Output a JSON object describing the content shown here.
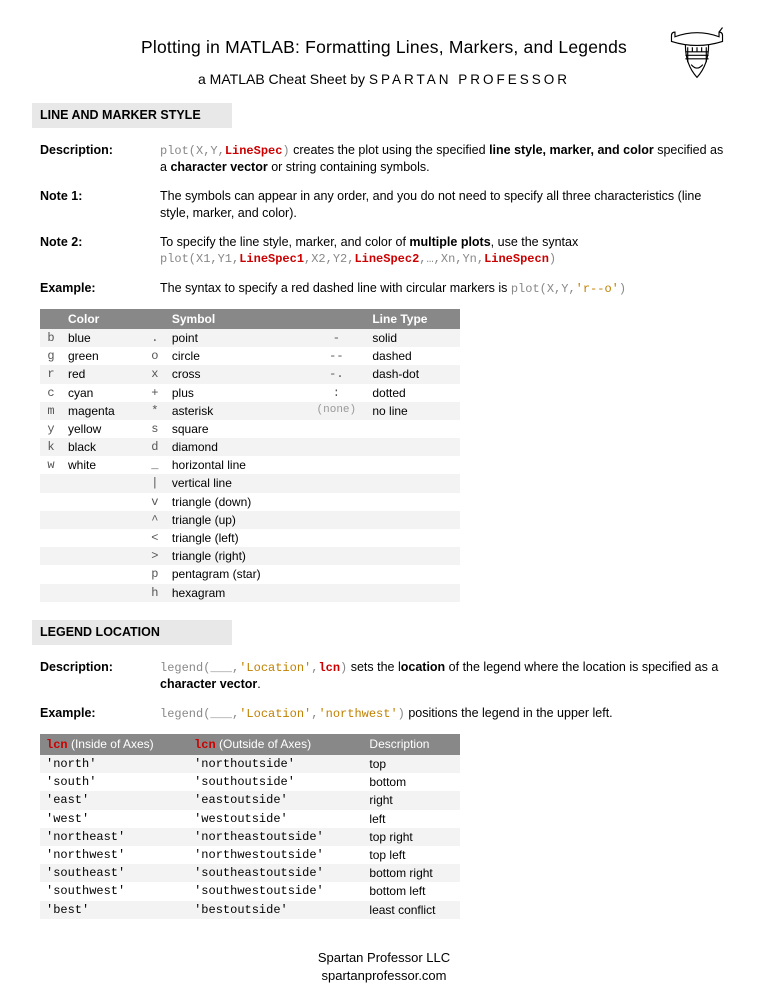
{
  "title": "Plotting in MATLAB: Formatting Lines, Markers, and Legends",
  "subtitle_prefix": "a MATLAB Cheat Sheet by ",
  "brand": "SPARTAN PROFESSOR",
  "section1": {
    "heading": "LINE AND MARKER STYLE",
    "desc_label": "Description:",
    "desc_code_pre": "plot(X,Y,",
    "desc_code_ls": "LineSpec",
    "desc_code_post": ")",
    "desc_text_a": " creates the plot using the specified ",
    "desc_text_b": "line style, marker, and color",
    "desc_text_c": " specified as a ",
    "desc_text_d": "character vector",
    "desc_text_e": " or string containing symbols.",
    "note1_label": "Note 1:",
    "note1_text": "The symbols can appear in any order, and you do not need to specify all three characteristics (line style, marker, and color).",
    "note2_label": "Note 2:",
    "note2_text_a": "To specify the line style, marker, and color of ",
    "note2_text_b": "multiple plots",
    "note2_text_c": ", use the syntax",
    "note2_code_pre": "plot(X1,Y1,",
    "note2_code_ls1": "LineSpec1",
    "note2_code_m1": ",X2,Y2,",
    "note2_code_ls2": "LineSpec2",
    "note2_code_m2": ",…,Xn,Yn,",
    "note2_code_ls3": "LineSpecn",
    "note2_code_post": ")",
    "ex_label": "Example:",
    "ex_text": "The syntax to specify a red dashed line with circular markers is ",
    "ex_code": "plot(X,Y,",
    "ex_code_str": "'r--o'",
    "ex_code_end": ")",
    "table": {
      "headers": {
        "color": "Color",
        "symbol": "Symbol",
        "line": "Line Type"
      },
      "rows": [
        {
          "cs": "b",
          "cn": "blue",
          "ss": ".",
          "sn": "point",
          "ls": "-",
          "ln": "solid"
        },
        {
          "cs": "g",
          "cn": "green",
          "ss": "o",
          "sn": "circle",
          "ls": "--",
          "ln": "dashed"
        },
        {
          "cs": "r",
          "cn": "red",
          "ss": "x",
          "sn": "cross",
          "ls": "-.",
          "ln": "dash-dot"
        },
        {
          "cs": "c",
          "cn": "cyan",
          "ss": "+",
          "sn": "plus",
          "ls": ":",
          "ln": "dotted"
        },
        {
          "cs": "m",
          "cn": "magenta",
          "ss": "*",
          "sn": "asterisk",
          "ls": "(none)",
          "ln": "no line"
        },
        {
          "cs": "y",
          "cn": "yellow",
          "ss": "s",
          "sn": "square",
          "ls": "",
          "ln": ""
        },
        {
          "cs": "k",
          "cn": "black",
          "ss": "d",
          "sn": "diamond",
          "ls": "",
          "ln": ""
        },
        {
          "cs": "w",
          "cn": "white",
          "ss": "_",
          "sn": "horizontal line",
          "ls": "",
          "ln": ""
        },
        {
          "cs": "",
          "cn": "",
          "ss": "|",
          "sn": "vertical line",
          "ls": "",
          "ln": ""
        },
        {
          "cs": "",
          "cn": "",
          "ss": "v",
          "sn": "triangle (down)",
          "ls": "",
          "ln": ""
        },
        {
          "cs": "",
          "cn": "",
          "ss": "^",
          "sn": "triangle (up)",
          "ls": "",
          "ln": ""
        },
        {
          "cs": "",
          "cn": "",
          "ss": "<",
          "sn": "triangle (left)",
          "ls": "",
          "ln": ""
        },
        {
          "cs": "",
          "cn": "",
          "ss": ">",
          "sn": "triangle (right)",
          "ls": "",
          "ln": ""
        },
        {
          "cs": "",
          "cn": "",
          "ss": "p",
          "sn": "pentagram (star)",
          "ls": "",
          "ln": ""
        },
        {
          "cs": "",
          "cn": "",
          "ss": "h",
          "sn": "hexagram",
          "ls": "",
          "ln": ""
        }
      ]
    }
  },
  "section2": {
    "heading": "LEGEND LOCATION",
    "desc_label": "Description:",
    "desc_code_pre": "legend(___,",
    "desc_code_loc": "'Location'",
    "desc_code_m": ",",
    "desc_code_lcn": "lcn",
    "desc_code_post": ")",
    "desc_text_a": " sets the l",
    "desc_text_b": "ocation",
    "desc_text_c": " of the legend where the location is specified as a ",
    "desc_text_d": "character vector",
    "desc_text_e": ".",
    "ex_label": "Example:",
    "ex_code_pre": "legend(___,",
    "ex_code_loc": "'Location'",
    "ex_code_m": ",",
    "ex_code_val": "'northwest'",
    "ex_code_post": ")",
    "ex_text": " positions the legend in the upper left.",
    "table": {
      "h1a": "lcn",
      "h1b": " (Inside of Axes)",
      "h2a": "lcn",
      "h2b": " (Outside of Axes)",
      "h3": "Description",
      "rows": [
        {
          "i": "'north'",
          "o": "'northoutside'",
          "d": "top"
        },
        {
          "i": "'south'",
          "o": "'southoutside'",
          "d": "bottom"
        },
        {
          "i": "'east'",
          "o": "'eastoutside'",
          "d": "right"
        },
        {
          "i": "'west'",
          "o": "'westoutside'",
          "d": "left"
        },
        {
          "i": "'northeast'",
          "o": "'northeastoutside'",
          "d": "top right"
        },
        {
          "i": "'northwest'",
          "o": "'northwestoutside'",
          "d": "top left"
        },
        {
          "i": "'southeast'",
          "o": "'southeastoutside'",
          "d": "bottom right"
        },
        {
          "i": "'southwest'",
          "o": "'southwestoutside'",
          "d": "bottom left"
        },
        {
          "i": "'best'",
          "o": "'bestoutside'",
          "d": "least conflict"
        }
      ]
    }
  },
  "footer": {
    "line1": "Spartan Professor LLC",
    "line2": "spartanprofessor.com"
  }
}
